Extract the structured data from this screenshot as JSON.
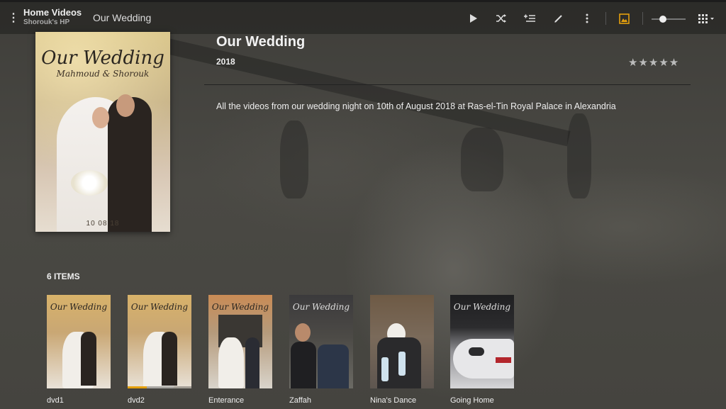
{
  "header": {
    "app_title": "Home Videos",
    "server": "Shorouk's HP",
    "breadcrumb": "Our Wedding",
    "accent": "#e5a00d",
    "tools": [
      "play-icon",
      "shuffle-icon",
      "add-to-queue-icon",
      "edit-icon",
      "more-icon",
      "poster-view-icon",
      "size-slider",
      "grid-view-icon"
    ]
  },
  "poster": {
    "title": "Our Wedding",
    "subtitle": "Mahmoud & Shorouk",
    "date": "10 08 18"
  },
  "detail": {
    "title": "Our Wedding",
    "year": "2018",
    "rating": "★★★★★",
    "description": "All the videos from our wedding night on 10th of August 2018 at Ras-el-Tin Royal Palace in Alexandria"
  },
  "items_count": "6 ITEMS",
  "items": [
    {
      "label": "dvd1",
      "poster_text": "Our Wedding",
      "progress": 0
    },
    {
      "label": "dvd2",
      "poster_text": "Our Wedding",
      "progress": 0.3
    },
    {
      "label": "Enterance",
      "poster_text": "Our Wedding",
      "progress": 0
    },
    {
      "label": "Zaffah",
      "poster_text": "Our Wedding",
      "progress": 0
    },
    {
      "label": "Nina's Dance",
      "poster_text": "",
      "progress": 0
    },
    {
      "label": "Going Home",
      "poster_text": "Our Wedding",
      "progress": 0
    }
  ]
}
